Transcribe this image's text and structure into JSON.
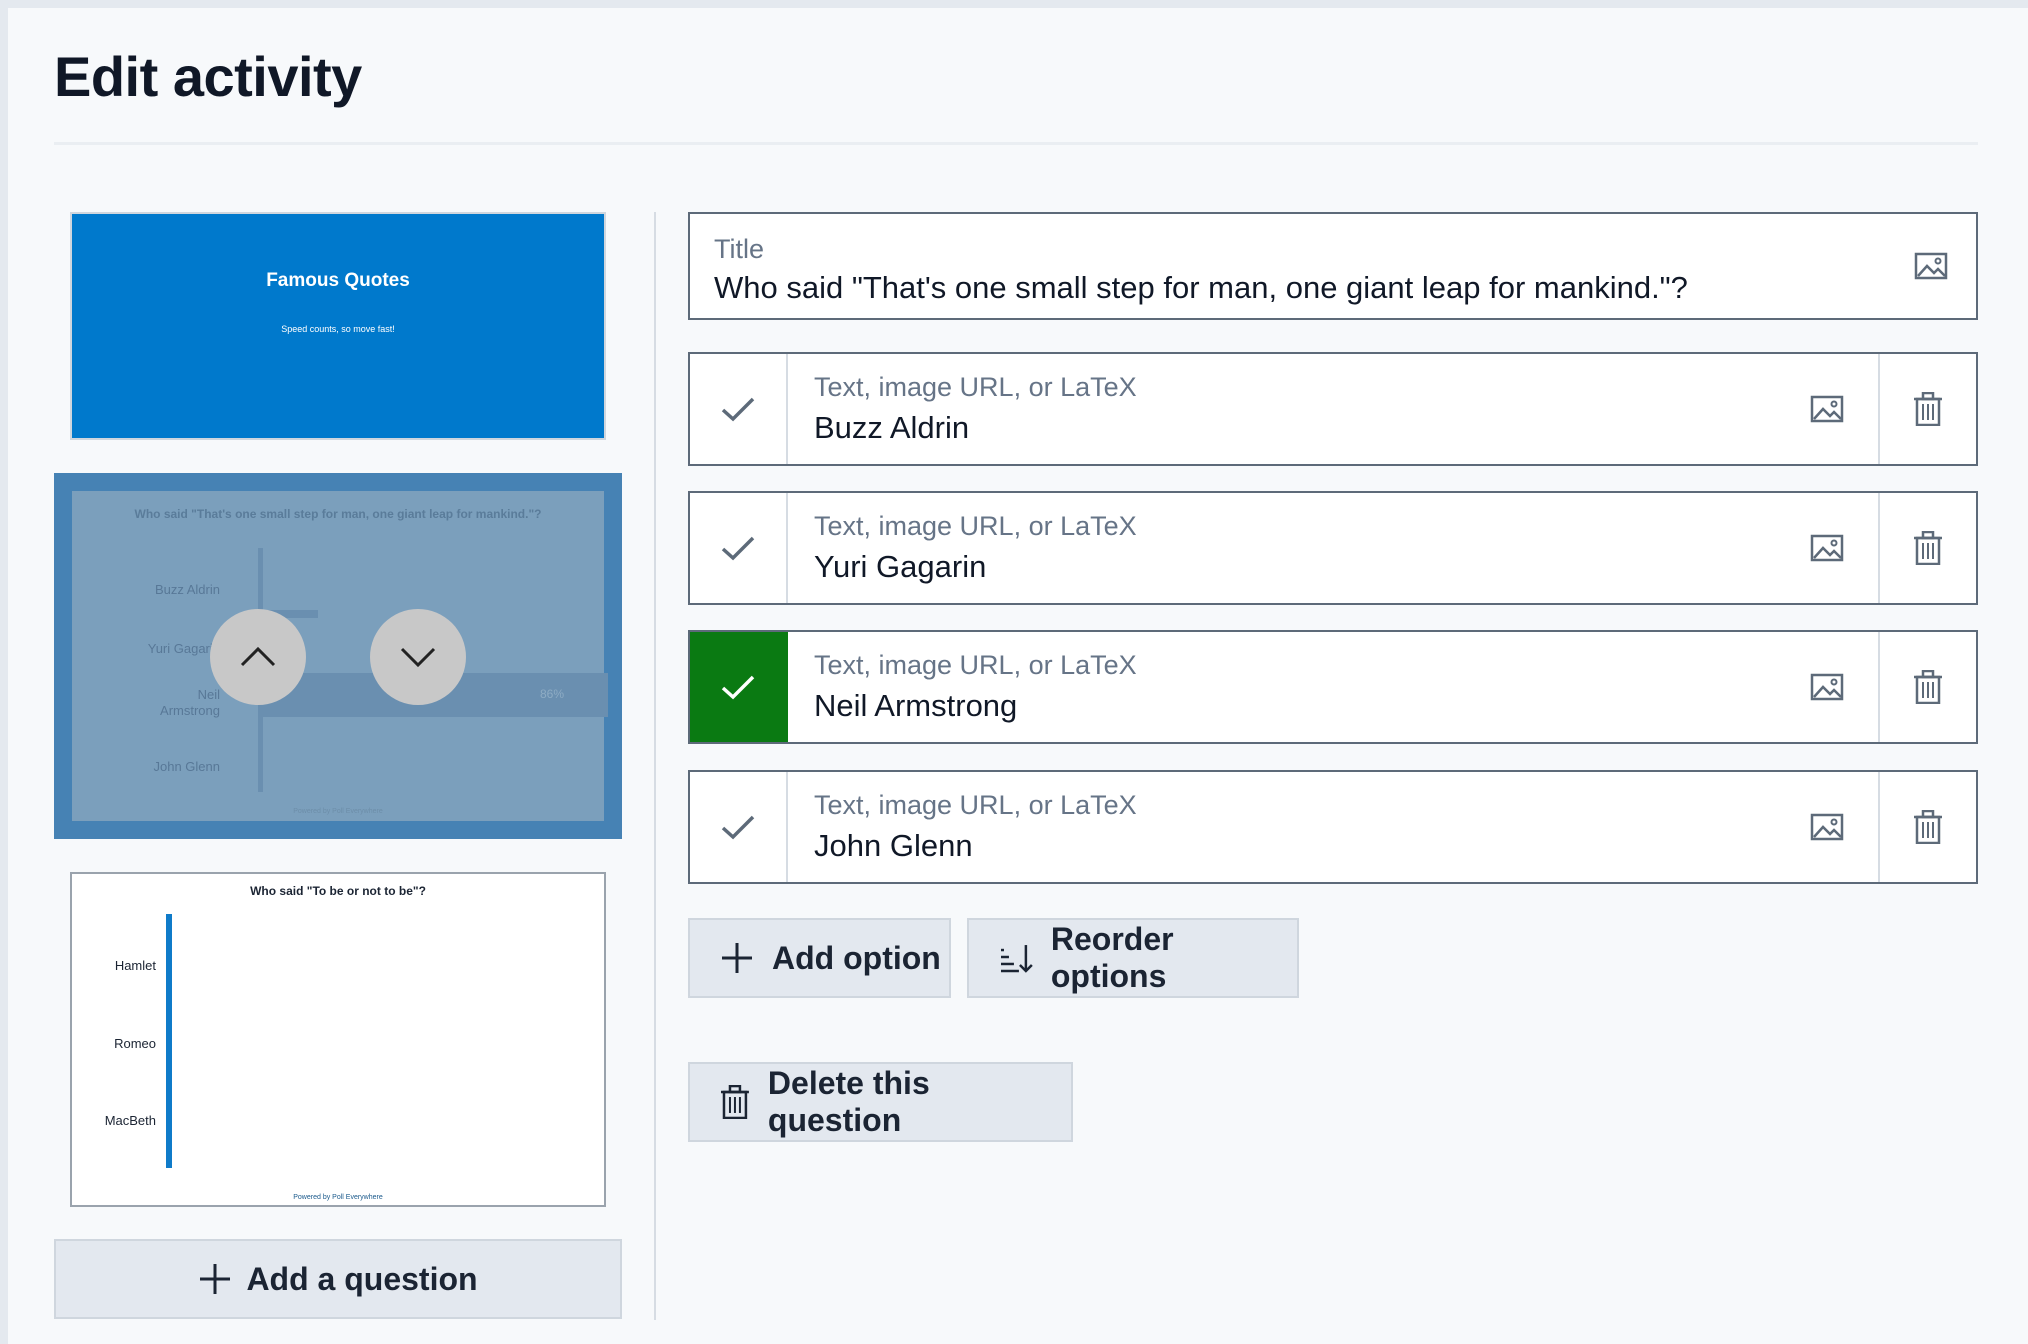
{
  "page": {
    "title": "Edit activity"
  },
  "slides": [
    {
      "title": "Famous Quotes",
      "subtitle": "Speed counts, so move fast!"
    },
    {
      "question": "Who said \"That's one small step for man, one giant leap for mankind.\"?",
      "options": [
        "Buzz Aldrin",
        "Yuri Gagarin",
        "Neil Armstrong",
        "John Glenn"
      ],
      "neil_line1": "Neil",
      "neil_line2": "Armstrong",
      "percent": "86%",
      "powered": "Powered by Poll Everywhere"
    },
    {
      "question": "Who said \"To be or not to be\"?",
      "options": [
        "Hamlet",
        "Romeo",
        "MacBeth"
      ],
      "powered": "Powered by Poll Everywhere"
    }
  ],
  "sidebar": {
    "add_question_label": "Add a question"
  },
  "editor": {
    "title_label": "Title",
    "title_value": "Who said \"That's one small step for man, one giant leap for mankind.\"?",
    "option_placeholder": "Text, image URL, or LaTeX",
    "options": [
      {
        "value": "Buzz Aldrin",
        "correct": false
      },
      {
        "value": "Yuri Gagarin",
        "correct": false
      },
      {
        "value": "Neil Armstrong",
        "correct": true
      },
      {
        "value": "John Glenn",
        "correct": false
      }
    ],
    "add_option_label": "Add option",
    "reorder_options_label": "Reorder options",
    "delete_question_label": "Delete this question"
  },
  "colors": {
    "accent_blue": "#0079cc",
    "correct_green": "#0a7a12",
    "selected_slide": "#4682b4"
  },
  "icons": {
    "image": "image-icon",
    "trash": "trash-icon",
    "check": "check-icon",
    "plus": "plus-icon",
    "sort": "sort-icon",
    "up": "chevron-up-icon",
    "down": "chevron-down-icon"
  }
}
